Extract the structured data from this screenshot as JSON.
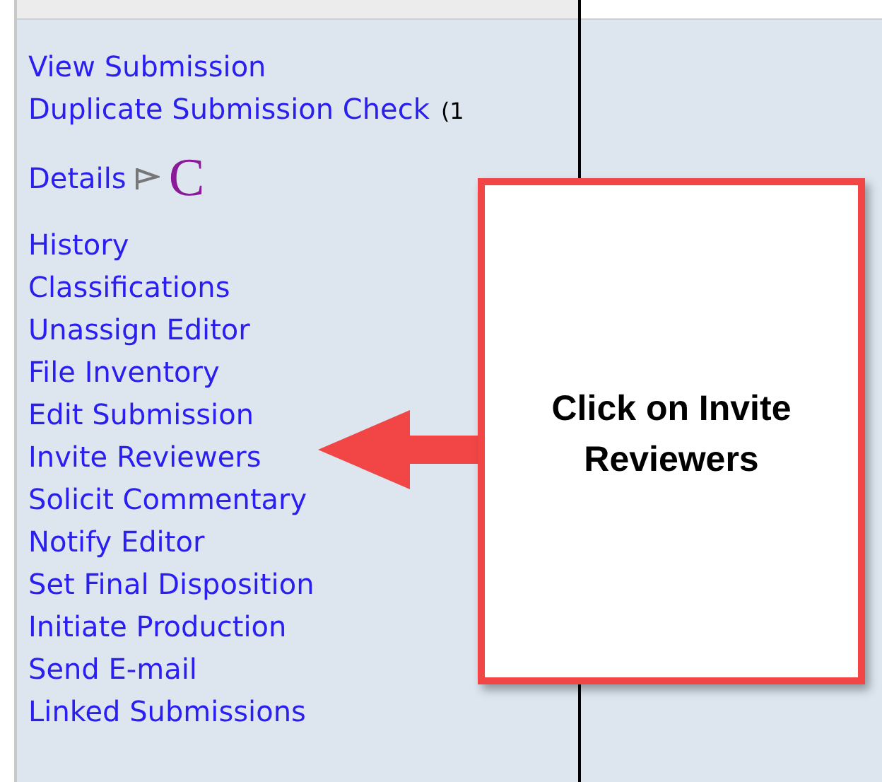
{
  "sidebar": {
    "top_links": [
      {
        "label": "View Submission"
      },
      {
        "label": "Duplicate Submission Check",
        "count": "(1"
      }
    ],
    "details": {
      "label": "Details",
      "badge": "C"
    },
    "links": [
      {
        "label": "History"
      },
      {
        "label": "Classifications"
      },
      {
        "label": "Unassign Editor"
      },
      {
        "label": "File Inventory"
      },
      {
        "label": "Edit Submission"
      },
      {
        "label": "Invite Reviewers"
      },
      {
        "label": "Solicit Commentary"
      },
      {
        "label": "Notify Editor"
      },
      {
        "label": "Set Final Disposition"
      },
      {
        "label": "Initiate Production"
      },
      {
        "label": "Send E-mail"
      },
      {
        "label": "Linked Submissions"
      }
    ]
  },
  "callout": {
    "text": "Click on Invite Reviewers"
  }
}
